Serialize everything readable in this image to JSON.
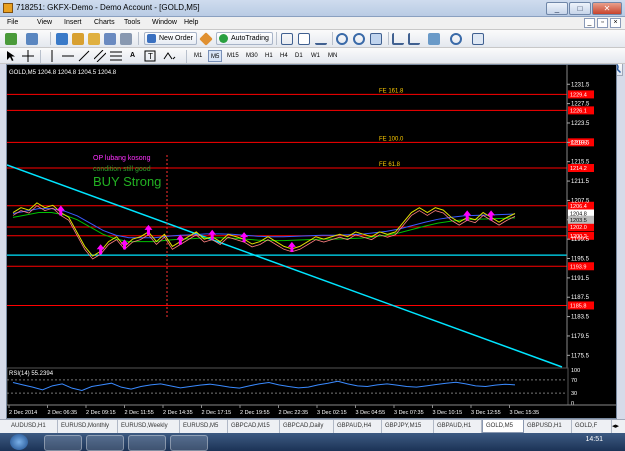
{
  "window": {
    "title": "718251: GKFX-Demo - Demo Account - [GOLD,M5]",
    "min_label": "_",
    "max_label": "□",
    "close_label": "✕"
  },
  "menu": {
    "items": [
      "File",
      "View",
      "Insert",
      "Charts",
      "Tools",
      "Window",
      "Help"
    ],
    "mdi_min": "_",
    "mdi_restore": "▫",
    "mdi_close": "×"
  },
  "toolbar": {
    "new_order": "New Order",
    "autotrading": "AutoTrading",
    "periods": [
      "M1",
      "M5",
      "M15",
      "M30",
      "H1",
      "H4",
      "D1",
      "W1",
      "MN"
    ],
    "active_period": "M5",
    "search_placeholder": ""
  },
  "chart": {
    "symbol_header": "GOLD,M5  1204.8 1204.8 1204.5 1204.8",
    "fe_labels": [
      "FE 161.8",
      "FE 100.0",
      "FE 61.8"
    ],
    "annotation_op": "OP lubang kosong",
    "annotation_condition": "condition still good",
    "annotation_buy": "BUY Strong",
    "rsi_label": "RSI(14) 55.2394",
    "colors": {
      "background": "#000000",
      "red_line": "#ff0000",
      "cyan_line": "#00e5ff",
      "magenta": "#ff00ff",
      "green": "#00c000",
      "yellow": "#e0e000",
      "orange_label": "#ffcc00"
    }
  },
  "chart_data": {
    "type": "line",
    "title": "GOLD,M5",
    "y_ticks": [
      1231.5,
      1227.5,
      1223.5,
      1219.5,
      1215.5,
      1211.5,
      1207.5,
      1203.5,
      1199.5,
      1195.5,
      1191.5,
      1187.5,
      1183.5,
      1179.5,
      1175.5
    ],
    "ylim": [
      1173.5,
      1233.0
    ],
    "red_levels": [
      {
        "price": 1229.4,
        "label": "1229.4"
      },
      {
        "price": 1226.1,
        "label": "1226.1"
      },
      {
        "price": 1219.5,
        "label": "1219.5"
      },
      {
        "price": 1214.2,
        "label": "1214.2"
      },
      {
        "price": 1206.4,
        "label": "1206.4"
      },
      {
        "price": 1202.0,
        "label": "1202.0"
      },
      {
        "price": 1200.2,
        "label": "1200.2"
      },
      {
        "price": 1193.9,
        "label": "1193.9"
      },
      {
        "price": 1185.8,
        "label": "1185.8"
      }
    ],
    "cyan_hline": 1196.2,
    "bid_label": "1204.8",
    "ask_label": "1203.5",
    "x_ticks": [
      "2 Dec 2014",
      "2 Dec 06:35",
      "2 Dec 09:15",
      "2 Dec 11:55",
      "2 Dec 14:35",
      "2 Dec 17:15",
      "2 Dec 19:55",
      "2 Dec 22:35",
      "3 Dec 02:15",
      "3 Dec 04:55",
      "3 Dec 07:35",
      "3 Dec 10:15",
      "3 Dec 12:55",
      "3 Dec 15:35"
    ],
    "price_series": [
      1205,
      1206,
      1205.5,
      1207,
      1206,
      1206.5,
      1205,
      1204,
      1201,
      1198,
      1196,
      1197,
      1199,
      1200,
      1198,
      1199.5,
      1200,
      1201,
      1199,
      1200.5,
      1198,
      1199,
      1200,
      1201,
      1199.5,
      1200,
      1199,
      1200.5,
      1200,
      1199.5,
      1198.5,
      1199,
      1200,
      1199,
      1198,
      1197.5,
      1198,
      1199,
      1200,
      1199.5,
      1200,
      1200.5,
      1200,
      1201,
      1200.5,
      1200,
      1201,
      1200.5,
      1201,
      1203,
      1205,
      1206,
      1205,
      1206,
      1205.5,
      1204,
      1203,
      1204,
      1203.5,
      1205,
      1204,
      1203,
      1204,
      1204.8
    ],
    "ma_series": [
      1204,
      1204.5,
      1205,
      1205,
      1204.5,
      1203.5,
      1202,
      1200.5,
      1199.5,
      1199,
      1199,
      1199,
      1199.3,
      1199.5,
      1199.6,
      1199.8,
      1199.8,
      1199.7,
      1199.5,
      1199.3,
      1199.2,
      1199.2,
      1199.3,
      1199.4,
      1199.5,
      1199.5,
      1199.6,
      1199.7,
      1200,
      1200.3,
      1200.8,
      1201.5,
      1202.2,
      1202.8,
      1203.2,
      1203.5,
      1203.6,
      1203.7,
      1203.8,
      1203.9
    ],
    "rsi": {
      "label": "RSI(14)",
      "value": 55.2394,
      "ticks": [
        100,
        70,
        30,
        0
      ],
      "series": [
        62,
        55,
        48,
        40,
        52,
        58,
        45,
        38,
        50,
        55,
        60,
        48,
        42,
        50,
        55,
        58,
        52,
        46,
        50,
        54,
        57,
        53,
        48,
        45,
        52,
        58,
        62,
        55,
        50,
        46,
        48,
        55,
        60,
        66,
        58,
        52,
        50,
        55,
        58,
        54,
        50,
        48,
        52,
        56,
        60,
        63,
        58,
        52,
        50,
        54,
        57,
        55
      ]
    }
  },
  "tabs": [
    "AUDUSD,H1",
    "EURUSD,Monthly",
    "EURUSD,Weekly",
    "EURUSD,M5",
    "GBPCAD,M15",
    "GBPCAD,Daily",
    "GBPAUD,H4",
    "GBPJPY,M15",
    "GBPAUD,H1",
    "GOLD,M5",
    "GBPUSD,H1",
    "GOLD,F"
  ],
  "active_tab": "GOLD,M5",
  "taskbar": {
    "clock": "14:51"
  }
}
